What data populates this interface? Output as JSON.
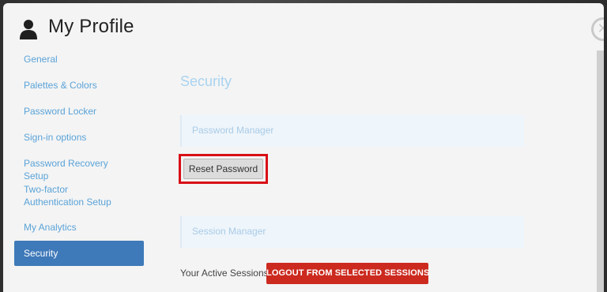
{
  "header": {
    "title": "My Profile",
    "icon": "user-icon",
    "close_icon": "close-icon"
  },
  "sidebar": {
    "items": [
      {
        "label": "General"
      },
      {
        "label": "Palettes & Colors"
      },
      {
        "label": "Password Locker"
      },
      {
        "label": "Sign-in options"
      },
      {
        "label": "Password Recovery Setup"
      },
      {
        "label": "Two-factor Authentication Setup"
      },
      {
        "label": "My Analytics"
      },
      {
        "label": "Security",
        "active": true
      }
    ]
  },
  "main": {
    "section_title": "Security",
    "password_manager_label": "Password Manager",
    "reset_password_label": "Reset Password",
    "session_manager_label": "Session Manager",
    "active_sessions_label": "Your Active Sessions",
    "logout_button_label": "LOGOUT FROM SELECTED SESSIONS"
  },
  "colors": {
    "accent": "#3e79b9",
    "link": "#5aa3d8",
    "danger": "#cc2a1f",
    "highlight": "#d80f16"
  }
}
